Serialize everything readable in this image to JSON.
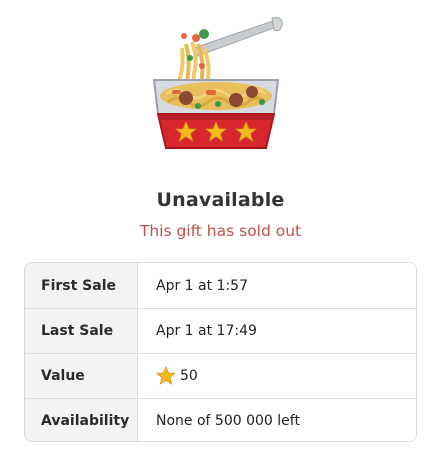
{
  "gift": {
    "image_icon": "noodle-box-icon",
    "title": "Unavailable",
    "subtitle": "This gift has sold out"
  },
  "details": {
    "rows": [
      {
        "label": "First Sale",
        "value": "Apr 1 at 1:57"
      },
      {
        "label": "Last Sale",
        "value": "Apr 1 at 17:49"
      },
      {
        "label": "Value",
        "value": "50",
        "icon": "star-icon"
      },
      {
        "label": "Availability",
        "value": "None of 500 000 left"
      }
    ]
  },
  "colors": {
    "subtitle": "#c0504d",
    "label_bg": "#f3f3f3",
    "border": "#d9d9d9",
    "star": "#f5b91e"
  }
}
